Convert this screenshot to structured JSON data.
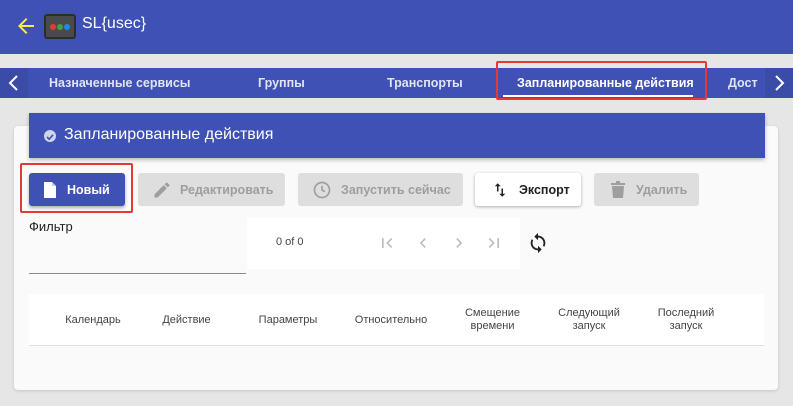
{
  "app": {
    "title": "SL{usec}",
    "logo_dots": [
      "#e53935",
      "#43a047",
      "#1e88e5"
    ]
  },
  "colors": {
    "primary": "#3f51b5",
    "highlight": "#e53935",
    "back_arrow": "#ffeb3b",
    "disabled_bg": "#dedede",
    "disabled_text": "#9e9e9e"
  },
  "tabs": [
    {
      "label": "Назначенные сервисы",
      "active": false
    },
    {
      "label": "Группы",
      "active": false
    },
    {
      "label": "Транспорты",
      "active": false
    },
    {
      "label": "Запланированные действия",
      "active": true
    },
    {
      "label": "Дост",
      "active": false
    }
  ],
  "section": {
    "title": "Запланированные действия"
  },
  "toolbar": {
    "new_label": "Новый",
    "edit_label": "Редактировать",
    "run_label": "Запустить сейчас",
    "export_label": "Экспорт",
    "delete_label": "Удалить"
  },
  "filter": {
    "label": "Фильтр",
    "value": ""
  },
  "pager": {
    "count_text": "0 of 0"
  },
  "table": {
    "columns": [
      "Календарь",
      "Действие",
      "Параметры",
      "Относительно",
      "Смещение времени",
      "Следующий запуск",
      "Последний запуск"
    ],
    "rows": []
  }
}
